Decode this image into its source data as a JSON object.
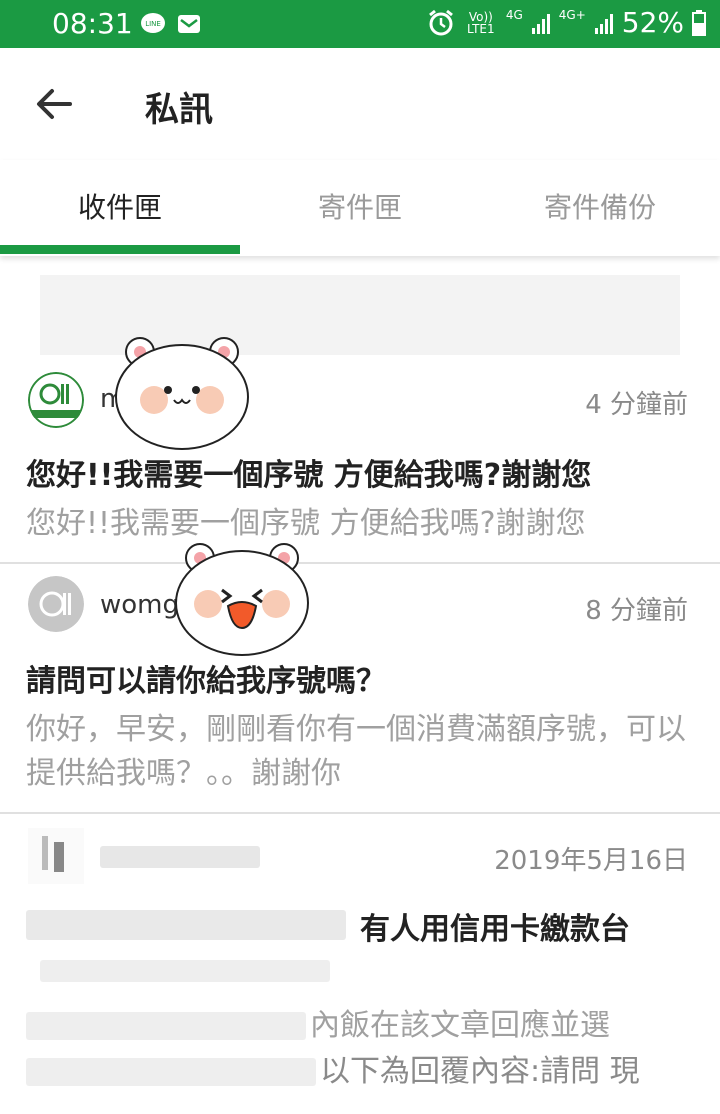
{
  "status": {
    "time": "08:31",
    "battery": "52%",
    "net1": "Vo)) LTE1",
    "net2": "4G",
    "net3": "4G+"
  },
  "appbar": {
    "title": "私訊"
  },
  "tabs": [
    {
      "label": "收件匣"
    },
    {
      "label": "寄件匣"
    },
    {
      "label": "寄件備份"
    }
  ],
  "messages": [
    {
      "sender": "m",
      "time": "4 分鐘前",
      "subject": "您好!!我需要一個序號 方便給我嗎?謝謝您",
      "preview": "您好!!我需要一個序號 方便給我嗎?謝謝您"
    },
    {
      "sender": "womg",
      "time": "8 分鐘前",
      "subject": "請問可以請你給我序號嗎？",
      "preview": "你好，早安，剛剛看你有一個消費滿額序號，可以提供給我嗎？。。謝謝你"
    },
    {
      "sender": "",
      "time": "2019年5月16日",
      "subject": "有人用信用卡繳款台",
      "preview1": "內飯在該文章回應並選",
      "preview2": "以下為回覆內容:請問 現"
    }
  ],
  "colors": {
    "brand": "#1b9a43"
  }
}
